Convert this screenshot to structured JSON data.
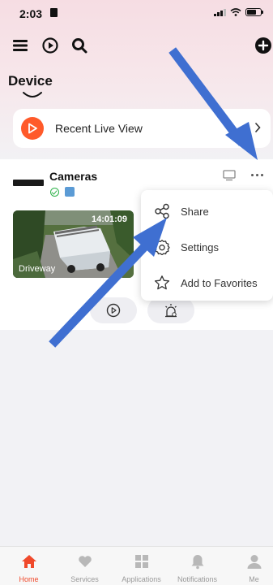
{
  "status_bar": {
    "time": "2:03"
  },
  "header": {
    "device_tab": "Device"
  },
  "recent": {
    "label": "Recent Live View"
  },
  "device_card": {
    "title": "Cameras",
    "thumbnail": {
      "timestamp": "14:01:09",
      "label": "Driveway"
    }
  },
  "context_menu": {
    "items": [
      {
        "label": "Share",
        "icon": "share-icon"
      },
      {
        "label": "Settings",
        "icon": "gear-icon"
      },
      {
        "label": "Add to Favorites",
        "icon": "star-icon"
      }
    ]
  },
  "tabbar": {
    "items": [
      {
        "label": "Home",
        "icon": "home-icon",
        "active": true
      },
      {
        "label": "Services",
        "icon": "heart-icon"
      },
      {
        "label": "Applications",
        "icon": "grid-icon"
      },
      {
        "label": "Notifications",
        "icon": "bell-icon"
      },
      {
        "label": "Me",
        "icon": "person-icon"
      }
    ]
  },
  "colors": {
    "accent": "#f0492b",
    "annotation_arrow": "#3f6fd1",
    "online": "#2fb24a"
  }
}
